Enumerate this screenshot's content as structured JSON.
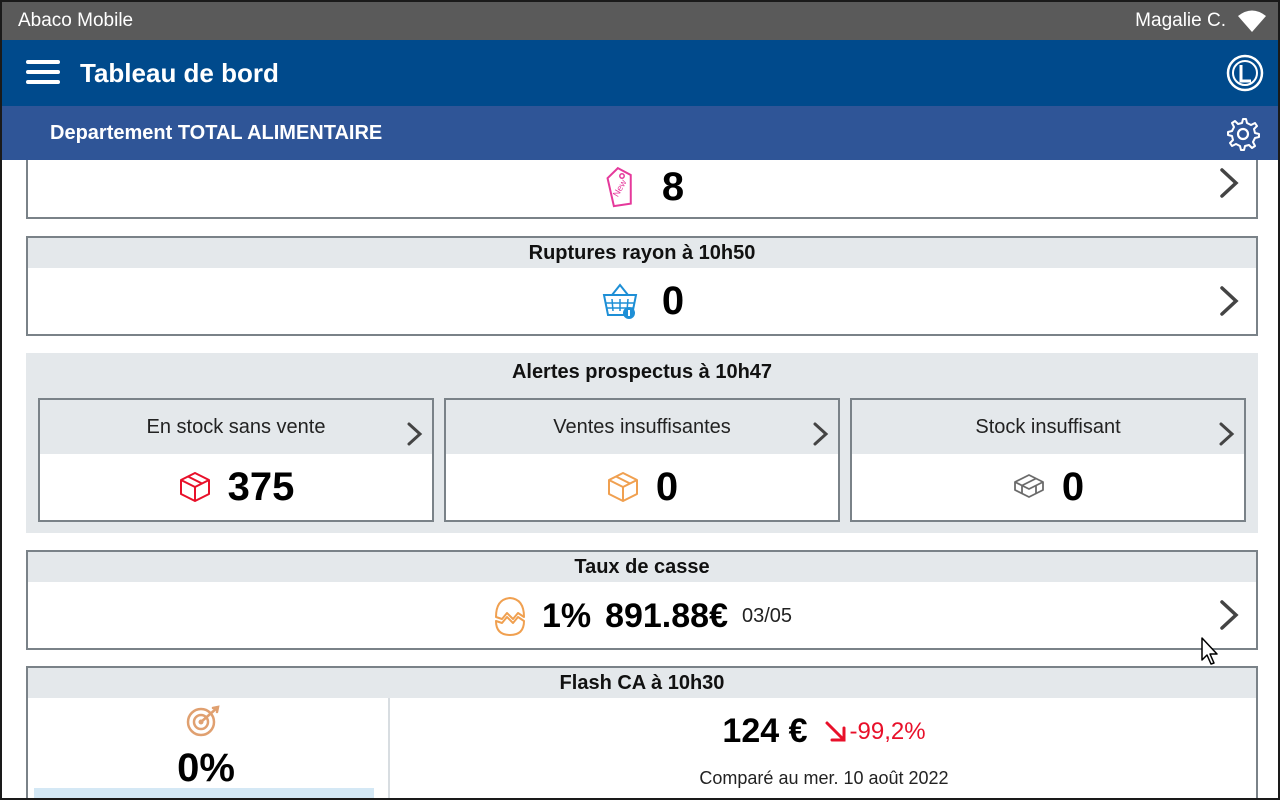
{
  "status_bar": {
    "app_name": "Abaco Mobile",
    "user_name": "Magalie C."
  },
  "app_bar": {
    "title": "Tableau de bord"
  },
  "department_bar": {
    "label": "Departement TOTAL ALIMENTAIRE"
  },
  "nouveautes_card": {
    "value": "8"
  },
  "ruptures_card": {
    "title": "Ruptures rayon à 10h50",
    "value": "0"
  },
  "prospectus": {
    "title": "Alertes prospectus à 10h47",
    "tiles": [
      {
        "label": "En stock sans vente",
        "value": "375",
        "icon_color": "#e8102a"
      },
      {
        "label": "Ventes insuffisantes",
        "value": "0",
        "icon_color": "#f0a050"
      },
      {
        "label": "Stock insuffisant",
        "value": "0",
        "icon_color": "#6b6b6b"
      }
    ]
  },
  "casse_card": {
    "title": "Taux de casse",
    "rate": "1%",
    "amount": "891.88€",
    "date": "03/05"
  },
  "flash_card": {
    "title": "Flash CA à 10h30",
    "target_percent": "0%",
    "amount": "124 €",
    "change": "-99,2%",
    "compared": "Comparé au mer. 10 août 2022"
  },
  "colors": {
    "app_bar": "#004a8c",
    "department_bar": "#2f5597",
    "negative": "#e8102a",
    "accent_blue": "#1e8fd6"
  }
}
